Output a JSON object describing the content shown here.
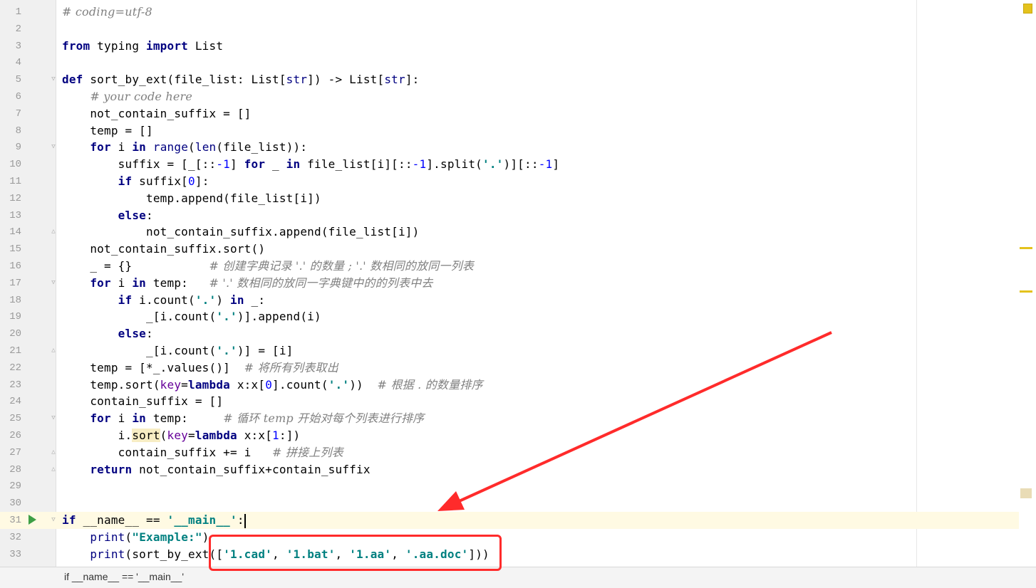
{
  "editor": {
    "lines": [
      {
        "n": "1",
        "tokens": [
          {
            "t": "# coding=utf-8",
            "c": "cm"
          }
        ]
      },
      {
        "n": "2",
        "tokens": []
      },
      {
        "n": "3",
        "tokens": [
          {
            "t": "from",
            "c": "kw"
          },
          {
            "t": " typing ",
            "c": "pu"
          },
          {
            "t": "import",
            "c": "kw"
          },
          {
            "t": " List",
            "c": "pu"
          }
        ]
      },
      {
        "n": "4",
        "tokens": []
      },
      {
        "n": "5",
        "fold": "open",
        "tokens": [
          {
            "t": "def",
            "c": "kw"
          },
          {
            "t": " sort_by_ext(file_list: List[",
            "c": "pu"
          },
          {
            "t": "str",
            "c": "bi"
          },
          {
            "t": "]) -> List[",
            "c": "pu"
          },
          {
            "t": "str",
            "c": "bi"
          },
          {
            "t": "]:",
            "c": "pu"
          }
        ]
      },
      {
        "n": "6",
        "tokens": [
          {
            "t": "    ",
            "c": "pu"
          },
          {
            "t": "# your code here",
            "c": "cm"
          }
        ]
      },
      {
        "n": "7",
        "tokens": [
          {
            "t": "    not_contain_suffix = []",
            "c": "pu"
          }
        ]
      },
      {
        "n": "8",
        "tokens": [
          {
            "t": "    temp = []",
            "c": "pu"
          }
        ]
      },
      {
        "n": "9",
        "fold": "open",
        "tokens": [
          {
            "t": "    ",
            "c": "pu"
          },
          {
            "t": "for",
            "c": "kw"
          },
          {
            "t": " i ",
            "c": "pu"
          },
          {
            "t": "in",
            "c": "kw"
          },
          {
            "t": " ",
            "c": "pu"
          },
          {
            "t": "range",
            "c": "bi"
          },
          {
            "t": "(",
            "c": "pu"
          },
          {
            "t": "len",
            "c": "bi"
          },
          {
            "t": "(file_list)):",
            "c": "pu"
          }
        ]
      },
      {
        "n": "10",
        "tokens": [
          {
            "t": "        suffix = [_[::",
            "c": "pu"
          },
          {
            "t": "-1",
            "c": "nm"
          },
          {
            "t": "] ",
            "c": "pu"
          },
          {
            "t": "for",
            "c": "kw"
          },
          {
            "t": " _ ",
            "c": "pu"
          },
          {
            "t": "in",
            "c": "kw"
          },
          {
            "t": " file_list[i][::",
            "c": "pu"
          },
          {
            "t": "-1",
            "c": "nm"
          },
          {
            "t": "].split(",
            "c": "pu"
          },
          {
            "t": "'.'",
            "c": "st"
          },
          {
            "t": ")][::",
            "c": "pu"
          },
          {
            "t": "-1",
            "c": "nm"
          },
          {
            "t": "]",
            "c": "pu"
          }
        ]
      },
      {
        "n": "11",
        "tokens": [
          {
            "t": "        ",
            "c": "pu"
          },
          {
            "t": "if",
            "c": "kw"
          },
          {
            "t": " suffix[",
            "c": "pu"
          },
          {
            "t": "0",
            "c": "nm"
          },
          {
            "t": "]:",
            "c": "pu"
          }
        ]
      },
      {
        "n": "12",
        "tokens": [
          {
            "t": "            temp.append(file_list[i])",
            "c": "pu"
          }
        ]
      },
      {
        "n": "13",
        "tokens": [
          {
            "t": "        ",
            "c": "pu"
          },
          {
            "t": "else",
            "c": "kw"
          },
          {
            "t": ":",
            "c": "pu"
          }
        ]
      },
      {
        "n": "14",
        "fold": "close",
        "tokens": [
          {
            "t": "            not_contain_suffix.append(file_list[i])",
            "c": "pu"
          }
        ]
      },
      {
        "n": "15",
        "tokens": [
          {
            "t": "    not_contain_suffix.sort()",
            "c": "pu"
          }
        ]
      },
      {
        "n": "16",
        "tokens": [
          {
            "t": "    _ = {}           ",
            "c": "pu"
          },
          {
            "t": "# 创建字典记录 '.' 的数量 ; '.' 数相同的放同一列表",
            "c": "cm"
          }
        ]
      },
      {
        "n": "17",
        "fold": "open",
        "tokens": [
          {
            "t": "    ",
            "c": "pu"
          },
          {
            "t": "for",
            "c": "kw"
          },
          {
            "t": " i ",
            "c": "pu"
          },
          {
            "t": "in",
            "c": "kw"
          },
          {
            "t": " temp:   ",
            "c": "pu"
          },
          {
            "t": "# '.' 数相同的放同一字典键中的的列表中去",
            "c": "cm"
          }
        ]
      },
      {
        "n": "18",
        "tokens": [
          {
            "t": "        ",
            "c": "pu"
          },
          {
            "t": "if",
            "c": "kw"
          },
          {
            "t": " i.count(",
            "c": "pu"
          },
          {
            "t": "'.'",
            "c": "st"
          },
          {
            "t": ") ",
            "c": "pu"
          },
          {
            "t": "in",
            "c": "kw"
          },
          {
            "t": " _:",
            "c": "pu"
          }
        ]
      },
      {
        "n": "19",
        "tokens": [
          {
            "t": "            _[i.count(",
            "c": "pu"
          },
          {
            "t": "'.'",
            "c": "st"
          },
          {
            "t": ")].append(i)",
            "c": "pu"
          }
        ]
      },
      {
        "n": "20",
        "tokens": [
          {
            "t": "        ",
            "c": "pu"
          },
          {
            "t": "else",
            "c": "kw"
          },
          {
            "t": ":",
            "c": "pu"
          }
        ]
      },
      {
        "n": "21",
        "fold": "close",
        "tokens": [
          {
            "t": "            _[i.count(",
            "c": "pu"
          },
          {
            "t": "'.'",
            "c": "st"
          },
          {
            "t": ")] = [i]",
            "c": "pu"
          }
        ]
      },
      {
        "n": "22",
        "tokens": [
          {
            "t": "    temp = [*_.values()]  ",
            "c": "pu"
          },
          {
            "t": "# 将所有列表取出",
            "c": "cm"
          }
        ]
      },
      {
        "n": "23",
        "tokens": [
          {
            "t": "    temp.sort(",
            "c": "pu"
          },
          {
            "t": "key",
            "c": "kp"
          },
          {
            "t": "=",
            "c": "pu"
          },
          {
            "t": "lambda",
            "c": "kw"
          },
          {
            "t": " x:x[",
            "c": "pu"
          },
          {
            "t": "0",
            "c": "nm"
          },
          {
            "t": "].count(",
            "c": "pu"
          },
          {
            "t": "'.'",
            "c": "st"
          },
          {
            "t": "))  ",
            "c": "pu"
          },
          {
            "t": "# 根据 . 的数量排序",
            "c": "cm"
          }
        ]
      },
      {
        "n": "24",
        "tokens": [
          {
            "t": "    contain_suffix = []",
            "c": "pu"
          }
        ]
      },
      {
        "n": "25",
        "fold": "open",
        "tokens": [
          {
            "t": "    ",
            "c": "pu"
          },
          {
            "t": "for",
            "c": "kw"
          },
          {
            "t": " i ",
            "c": "pu"
          },
          {
            "t": "in",
            "c": "kw"
          },
          {
            "t": " temp:     ",
            "c": "pu"
          },
          {
            "t": "# 循环 temp 开始对每个列表进行排序",
            "c": "cm"
          }
        ]
      },
      {
        "n": "26",
        "tokens": [
          {
            "t": "        i.",
            "c": "pu"
          },
          {
            "t": "sort",
            "c": "hl"
          },
          {
            "t": "(",
            "c": "pu"
          },
          {
            "t": "key",
            "c": "kp"
          },
          {
            "t": "=",
            "c": "pu"
          },
          {
            "t": "lambda",
            "c": "kw"
          },
          {
            "t": " x:x[",
            "c": "pu"
          },
          {
            "t": "1",
            "c": "nm"
          },
          {
            "t": ":])",
            "c": "pu"
          }
        ]
      },
      {
        "n": "27",
        "fold": "close",
        "tokens": [
          {
            "t": "        contain_suffix += i   ",
            "c": "pu"
          },
          {
            "t": "# 拼接上列表",
            "c": "cm"
          }
        ]
      },
      {
        "n": "28",
        "fold": "close",
        "tokens": [
          {
            "t": "    ",
            "c": "pu"
          },
          {
            "t": "return",
            "c": "kw"
          },
          {
            "t": " not_contain_suffix+contain_suffix",
            "c": "pu"
          }
        ]
      },
      {
        "n": "29",
        "tokens": []
      },
      {
        "n": "30",
        "tokens": []
      },
      {
        "n": "31",
        "current": true,
        "run": true,
        "fold": "open",
        "tokens": [
          {
            "t": "if",
            "c": "kw"
          },
          {
            "t": " __name__ == ",
            "c": "pu"
          },
          {
            "t": "'__main__'",
            "c": "st"
          },
          {
            "t": ":",
            "c": "pu"
          }
        ]
      },
      {
        "n": "32",
        "tokens": [
          {
            "t": "    ",
            "c": "pu"
          },
          {
            "t": "print",
            "c": "bi"
          },
          {
            "t": "(",
            "c": "pu"
          },
          {
            "t": "\"Example:\"",
            "c": "st"
          },
          {
            "t": ")",
            "c": "pu"
          }
        ]
      },
      {
        "n": "33",
        "tokens": [
          {
            "t": "    ",
            "c": "pu"
          },
          {
            "t": "print",
            "c": "bi"
          },
          {
            "t": "(sort_by_ext([",
            "c": "pu"
          },
          {
            "t": "'1.cad'",
            "c": "st"
          },
          {
            "t": ", ",
            "c": "pu"
          },
          {
            "t": "'1.bat'",
            "c": "st"
          },
          {
            "t": ", ",
            "c": "pu"
          },
          {
            "t": "'1.aa'",
            "c": "st"
          },
          {
            "t": ", ",
            "c": "pu"
          },
          {
            "t": "'.aa.doc'",
            "c": "st"
          },
          {
            "t": "]))",
            "c": "pu"
          }
        ]
      }
    ]
  },
  "statusbar": {
    "breadcrumb": "if __name__ == '__main__'"
  },
  "colors": {
    "keyword": "#000080",
    "string": "#008080",
    "comment": "#808080",
    "number": "#0000ff",
    "annotation": "#ff2b2b"
  }
}
